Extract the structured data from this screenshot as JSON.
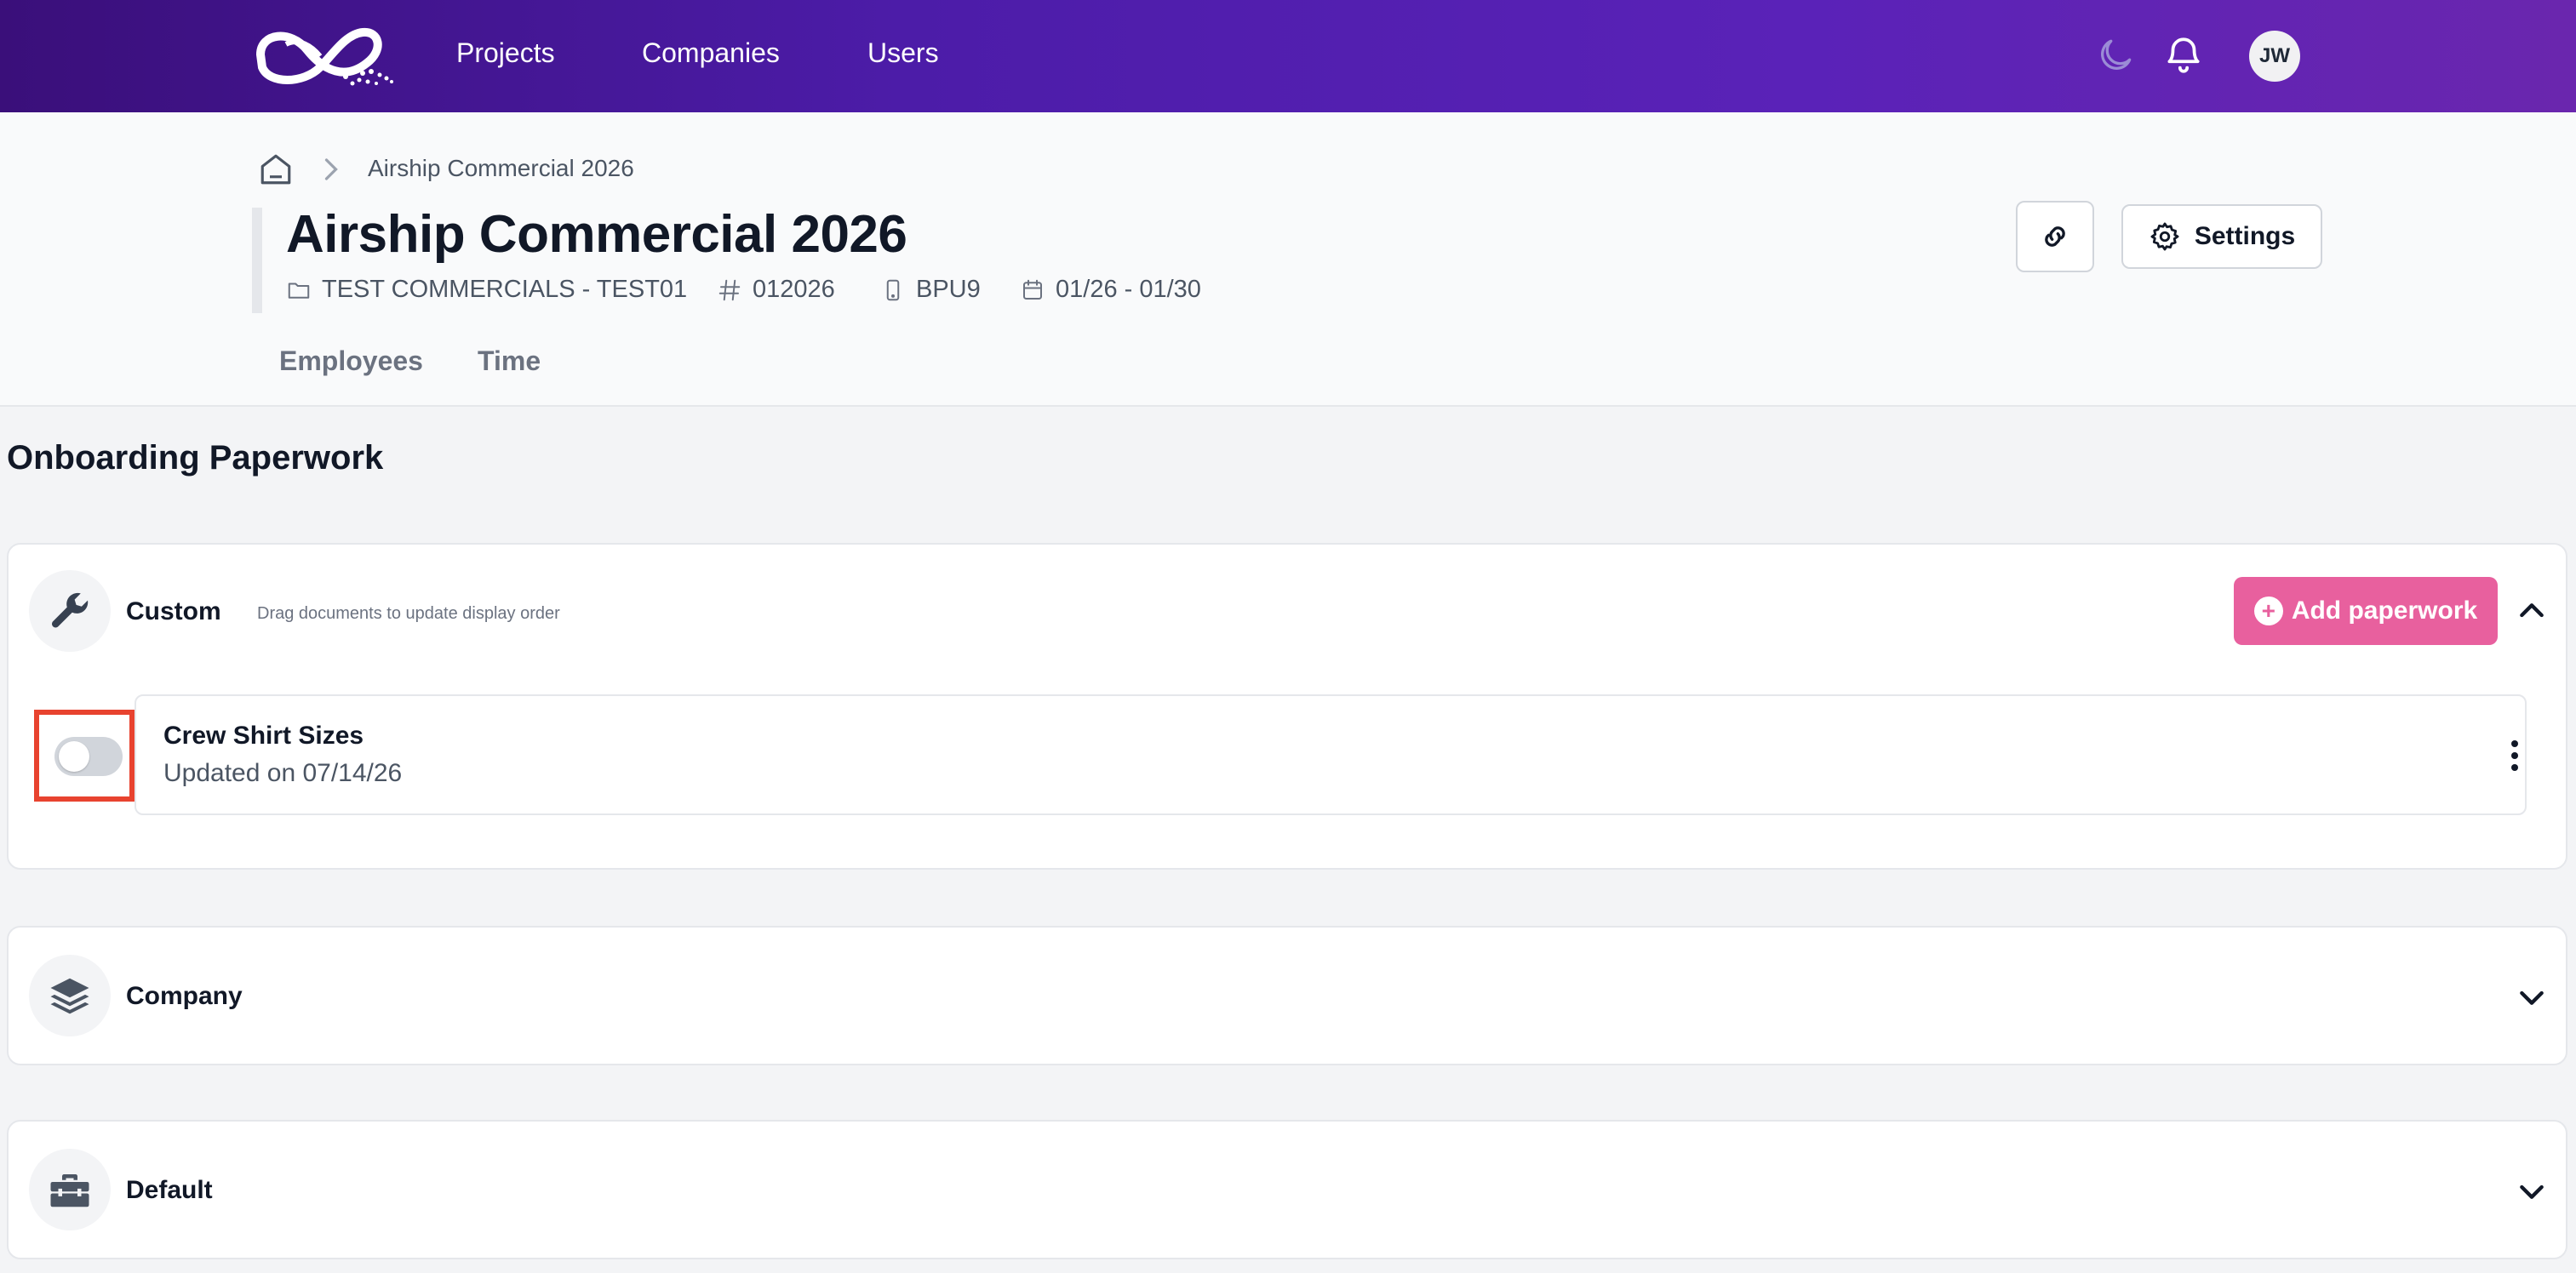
{
  "nav": {
    "links": [
      "Projects",
      "Companies",
      "Users"
    ],
    "avatar_initials": "JW",
    "icons": [
      "logo-icon",
      "moon-icon",
      "bell-icon"
    ]
  },
  "breadcrumb": {
    "current": "Airship Commercial 2026"
  },
  "project": {
    "title": "Airship Commercial 2026",
    "company": "TEST COMMERCIALS - TEST01",
    "number": "012026",
    "code": "BPU9",
    "dates": "01/26 - 01/30"
  },
  "tabs": [
    "Employees",
    "Time"
  ],
  "actions": {
    "settings_label": "Settings"
  },
  "section": {
    "title": "Onboarding Paperwork"
  },
  "groups": {
    "custom": {
      "title": "Custom",
      "hint": "Drag documents to update display order",
      "add_label": "Add paperwork",
      "documents": [
        {
          "name": "Crew Shirt Sizes",
          "updated": "Updated on 07/14/26",
          "enabled": false
        }
      ]
    },
    "company": {
      "title": "Company"
    },
    "default": {
      "title": "Default"
    }
  },
  "colors": {
    "nav_gradient_start": "#3a0f7a",
    "nav_gradient_end": "#6a26ae",
    "accent_pink": "#e8609e",
    "highlight_red": "#e8432f"
  }
}
